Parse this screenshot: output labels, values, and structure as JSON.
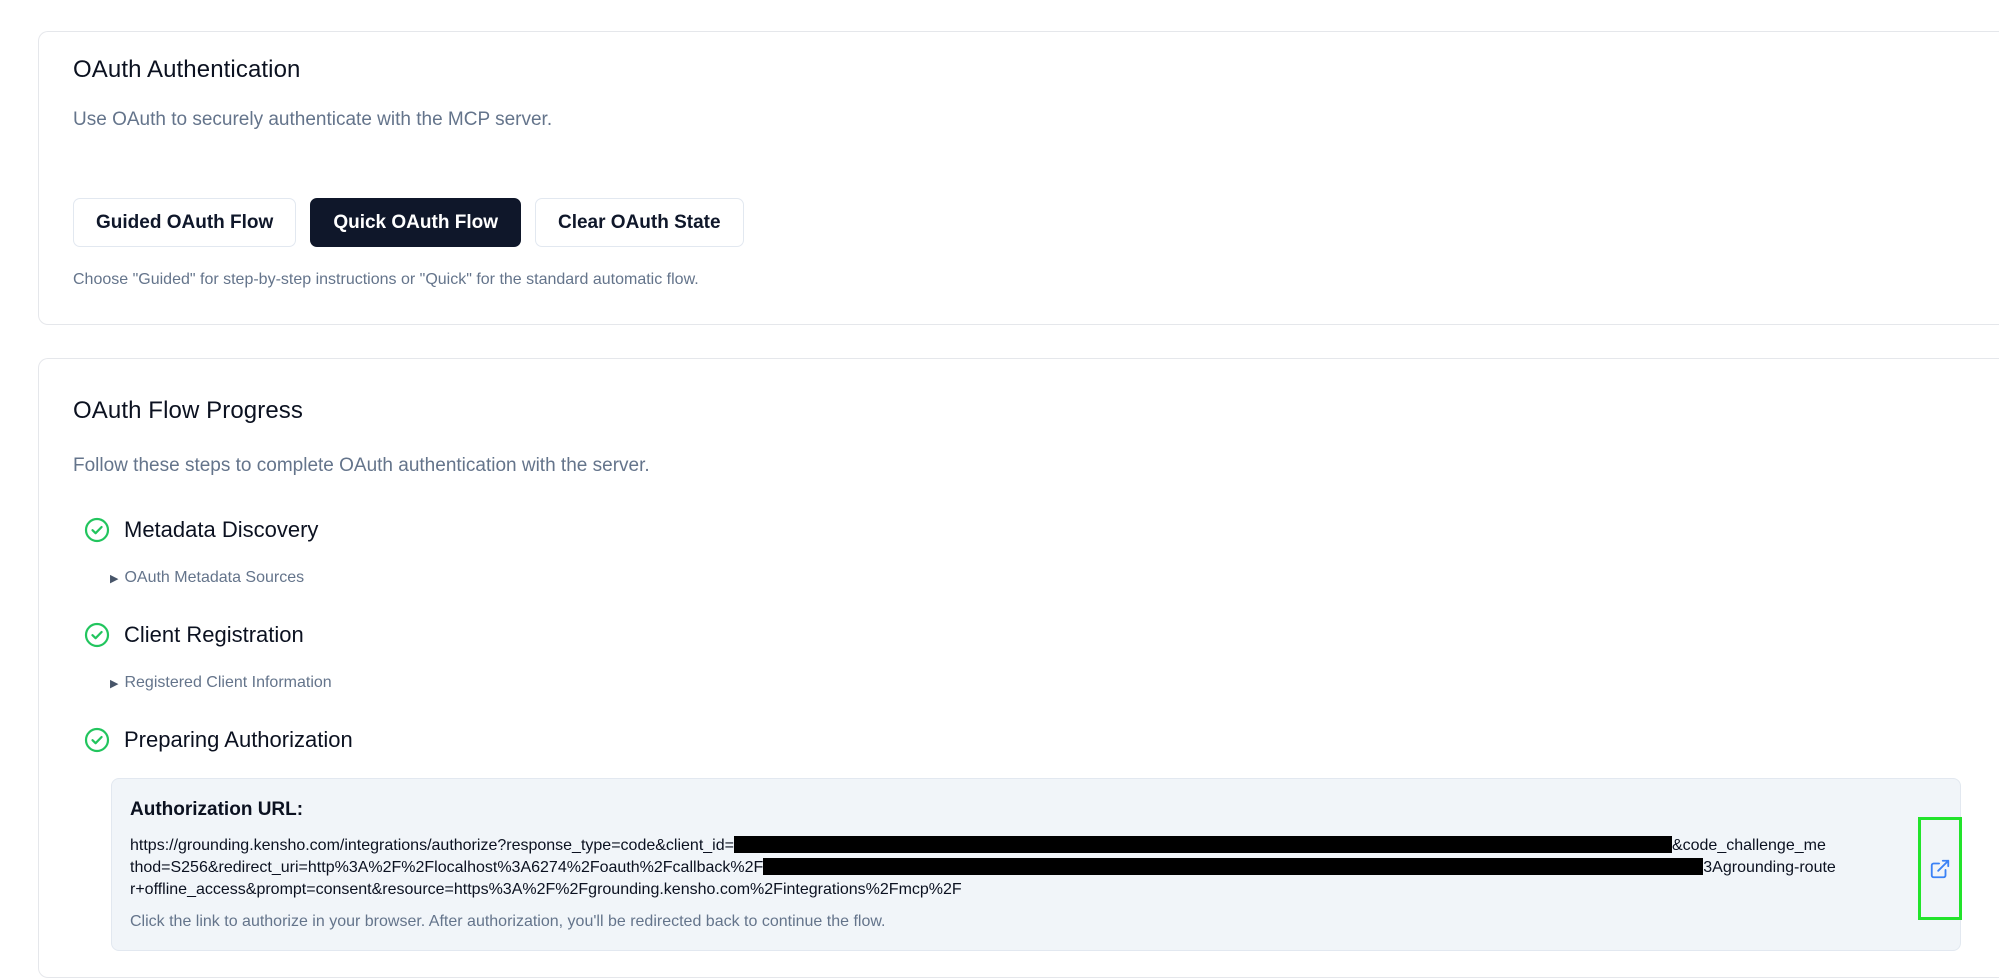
{
  "oauth_auth": {
    "title": "OAuth Authentication",
    "description": "Use OAuth to securely authenticate with the MCP server.",
    "buttons": {
      "guided": "Guided OAuth Flow",
      "quick": "Quick OAuth Flow",
      "clear": "Clear OAuth State"
    },
    "helper": "Choose \"Guided\" for step-by-step instructions or \"Quick\" for the standard automatic flow."
  },
  "progress": {
    "title": "OAuth Flow Progress",
    "description": "Follow these steps to complete OAuth authentication with the server.",
    "steps": [
      {
        "label": "Metadata Discovery",
        "status": "complete",
        "details_label": "OAuth Metadata Sources"
      },
      {
        "label": "Client Registration",
        "status": "complete",
        "details_label": "Registered Client Information"
      },
      {
        "label": "Preparing Authorization",
        "status": "complete"
      }
    ],
    "authorization": {
      "label": "Authorization URL:",
      "url_line1_a": "https://grounding.kensho.com/integrations/authorize?response_type=code&client_id=",
      "url_line1_b": "&code_challenge_me",
      "url_line2_a": "thod=S256&redirect_uri=http%3A%2F%2Flocalhost%3A6274%2Foauth%2Fcallback%2F",
      "url_line2_b": "3Agrounding-route",
      "url_line3": "r+offline_access&prompt=consent&resource=https%3A%2F%2Fgrounding.kensho.com%2Fintegrations%2Fmcp%2F",
      "note": "Click the link to authorize in your browser. After authorization, you'll be redirected back to continue the flow."
    }
  },
  "colors": {
    "primary_button": "#0f172a",
    "success_green": "#22c55e",
    "link_blue": "#3b82f6",
    "highlight_box": "#22e32b"
  },
  "icons": {
    "step_status": "check-circle-icon",
    "disclosure": "triangle-right-icon",
    "open_link": "external-link-icon"
  }
}
